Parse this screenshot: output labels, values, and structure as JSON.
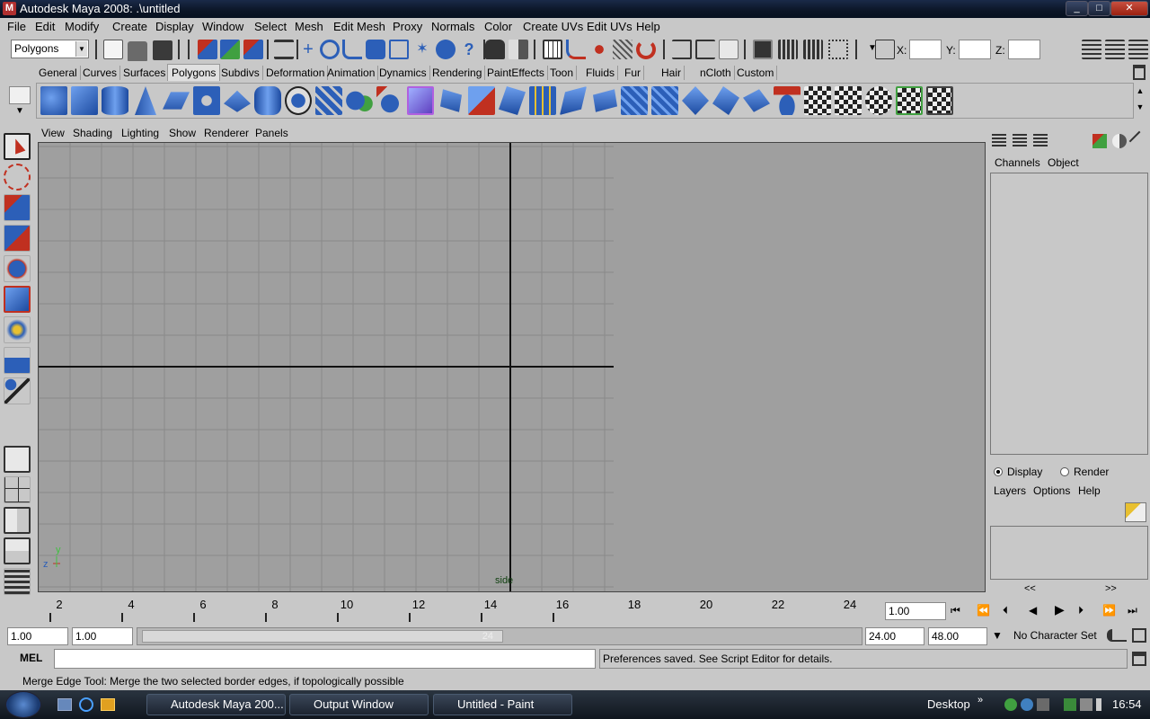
{
  "window": {
    "title": "Autodesk Maya 2008: .\\untitled",
    "logo": "M",
    "min": "_",
    "max": "□",
    "close": "✕"
  },
  "menus": [
    "File",
    "Edit",
    "Modify",
    "Create",
    "Display",
    "Window",
    "Select",
    "Mesh",
    "Edit Mesh",
    "Proxy",
    "Normals",
    "Color",
    "Create UVs",
    "Edit UVs",
    "Help"
  ],
  "status_line": {
    "menu_set": "Polygons",
    "x_label": "X:",
    "y_label": "Y:",
    "z_label": "Z:"
  },
  "shelf_tabs": [
    "General",
    "Curves",
    "Surfaces",
    "Polygons",
    "Subdivs",
    "Deformation",
    "Animation",
    "Dynamics",
    "Rendering",
    "PaintEffects",
    "Toon",
    "Fluids",
    "Fur",
    "Hair",
    "nCloth",
    "Custom"
  ],
  "active_shelf": "Polygons",
  "panel_menus": [
    "View",
    "Shading",
    "Lighting",
    "Show",
    "Renderer",
    "Panels"
  ],
  "viewport": {
    "camera_label": "side",
    "axis_z": "z",
    "axis_y": "y"
  },
  "channel_box": {
    "tabs": [
      "Channels",
      "Object"
    ],
    "radio_display": "Display",
    "radio_render": "Render",
    "layer_menus": [
      "Layers",
      "Options",
      "Help"
    ],
    "scroll_left": "<<",
    "scroll_right": ">>"
  },
  "time_slider": {
    "ticks": [
      "2",
      "4",
      "6",
      "8",
      "10",
      "12",
      "14",
      "16",
      "18",
      "20",
      "22",
      "24"
    ],
    "current_frame": "1.00"
  },
  "range_slider": {
    "start": "1.00",
    "range_start": "1.00",
    "handle_label": "24",
    "range_end": "24.00",
    "end": "48.00",
    "character_set": "No Character Set"
  },
  "command_line": {
    "label": "MEL",
    "feedback": "Preferences saved. See Script Editor for details."
  },
  "help_line": "Merge Edge Tool: Merge the two selected border edges, if topologically possible",
  "taskbar": {
    "buttons": [
      "Autodesk Maya 200...",
      "Output Window",
      "Untitled - Paint"
    ],
    "desktop": "Desktop",
    "time": "16:54"
  },
  "colors": {
    "viewport": "#9f9f9f",
    "grid": "#8a8a8a",
    "ui_bg": "#c8c8c8",
    "icon_blue": "#2c5fb8"
  }
}
